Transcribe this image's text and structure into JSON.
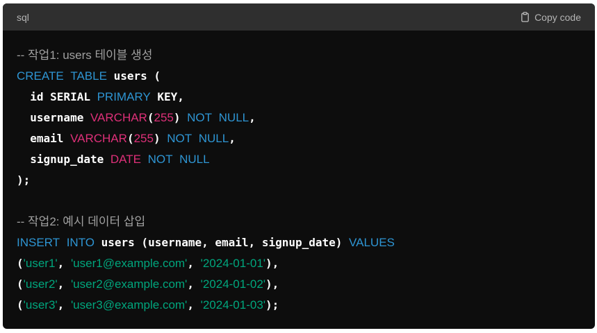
{
  "header": {
    "language": "sql",
    "copy_label": "Copy code",
    "copy_icon": "clipboard-icon"
  },
  "colors": {
    "keyword": "#2e95d3",
    "type": "#df3079",
    "string": "#00a67d",
    "comment": "#a0a0a0",
    "plain": "#ffffff",
    "background": "#0d0d0d",
    "header_background": "#2f2f2f"
  },
  "code": {
    "lines": [
      [
        {
          "t": "-- 작업1: users 테이블 생성",
          "c": "cmt"
        }
      ],
      [
        {
          "t": "CREATE",
          "c": "kw"
        },
        {
          "t": " ",
          "c": "plain"
        },
        {
          "t": "TABLE",
          "c": "kw"
        },
        {
          "t": " users (",
          "c": "plain"
        }
      ],
      [
        {
          "t": "  id SERIAL ",
          "c": "plain"
        },
        {
          "t": "PRIMARY",
          "c": "kw"
        },
        {
          "t": " KEY,",
          "c": "plain"
        }
      ],
      [
        {
          "t": "  username ",
          "c": "plain"
        },
        {
          "t": "VARCHAR",
          "c": "type"
        },
        {
          "t": "(",
          "c": "plain"
        },
        {
          "t": "255",
          "c": "num"
        },
        {
          "t": ") ",
          "c": "plain"
        },
        {
          "t": "NOT",
          "c": "kw"
        },
        {
          "t": " ",
          "c": "plain"
        },
        {
          "t": "NULL",
          "c": "kw"
        },
        {
          "t": ",",
          "c": "plain"
        }
      ],
      [
        {
          "t": "  email ",
          "c": "plain"
        },
        {
          "t": "VARCHAR",
          "c": "type"
        },
        {
          "t": "(",
          "c": "plain"
        },
        {
          "t": "255",
          "c": "num"
        },
        {
          "t": ") ",
          "c": "plain"
        },
        {
          "t": "NOT",
          "c": "kw"
        },
        {
          "t": " ",
          "c": "plain"
        },
        {
          "t": "NULL",
          "c": "kw"
        },
        {
          "t": ",",
          "c": "plain"
        }
      ],
      [
        {
          "t": "  signup_date ",
          "c": "plain"
        },
        {
          "t": "DATE",
          "c": "type"
        },
        {
          "t": " ",
          "c": "plain"
        },
        {
          "t": "NOT",
          "c": "kw"
        },
        {
          "t": " ",
          "c": "plain"
        },
        {
          "t": "NULL",
          "c": "kw"
        }
      ],
      [
        {
          "t": ");",
          "c": "plain"
        }
      ],
      [],
      [
        {
          "t": "-- 작업2: 예시 데이터 삽입",
          "c": "cmt"
        }
      ],
      [
        {
          "t": "INSERT",
          "c": "kw"
        },
        {
          "t": " ",
          "c": "plain"
        },
        {
          "t": "INTO",
          "c": "kw"
        },
        {
          "t": " users (username, email, signup_date) ",
          "c": "plain"
        },
        {
          "t": "VALUES",
          "c": "kw"
        }
      ],
      [
        {
          "t": "(",
          "c": "plain"
        },
        {
          "t": "'user1'",
          "c": "str"
        },
        {
          "t": ", ",
          "c": "plain"
        },
        {
          "t": "'user1@example.com'",
          "c": "str"
        },
        {
          "t": ", ",
          "c": "plain"
        },
        {
          "t": "'2024-01-01'",
          "c": "str"
        },
        {
          "t": "),",
          "c": "plain"
        }
      ],
      [
        {
          "t": "(",
          "c": "plain"
        },
        {
          "t": "'user2'",
          "c": "str"
        },
        {
          "t": ", ",
          "c": "plain"
        },
        {
          "t": "'user2@example.com'",
          "c": "str"
        },
        {
          "t": ", ",
          "c": "plain"
        },
        {
          "t": "'2024-01-02'",
          "c": "str"
        },
        {
          "t": "),",
          "c": "plain"
        }
      ],
      [
        {
          "t": "(",
          "c": "plain"
        },
        {
          "t": "'user3'",
          "c": "str"
        },
        {
          "t": ", ",
          "c": "plain"
        },
        {
          "t": "'user3@example.com'",
          "c": "str"
        },
        {
          "t": ", ",
          "c": "plain"
        },
        {
          "t": "'2024-01-03'",
          "c": "str"
        },
        {
          "t": ");",
          "c": "plain"
        }
      ]
    ]
  }
}
